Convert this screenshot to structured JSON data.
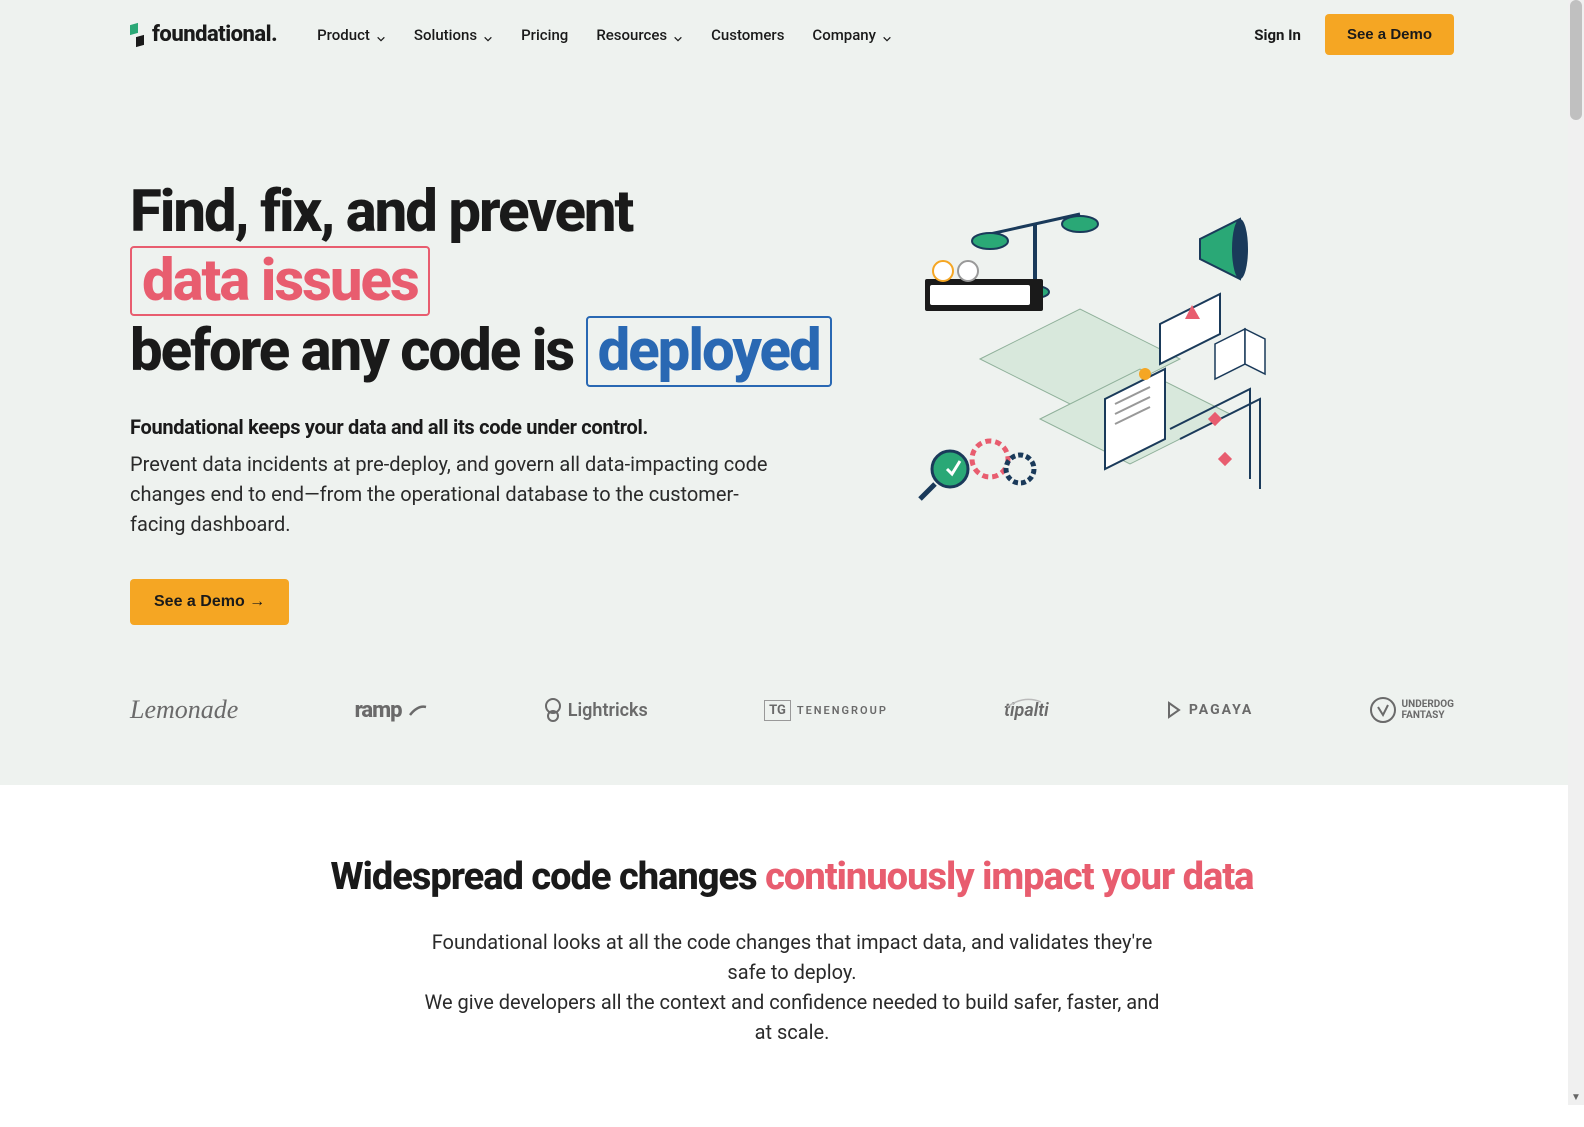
{
  "brand": {
    "name": "foundational."
  },
  "nav": {
    "items": [
      {
        "label": "Product",
        "has_chevron": true
      },
      {
        "label": "Solutions",
        "has_chevron": true
      },
      {
        "label": "Pricing",
        "has_chevron": false
      },
      {
        "label": "Resources",
        "has_chevron": true
      },
      {
        "label": "Customers",
        "has_chevron": false
      },
      {
        "label": "Company",
        "has_chevron": true
      }
    ],
    "signin": "Sign In",
    "cta": "See a Demo"
  },
  "hero": {
    "title_part1": "Find, fix, and prevent",
    "title_highlight1": "data issues",
    "title_part2": "before any code is",
    "title_highlight2": "deployed",
    "sub_bold": "Foundational keeps your data and all its code under control.",
    "sub": "Prevent data incidents at pre-deploy, and govern all data-impacting code changes end to end—from the operational database to the customer-facing dashboard.",
    "cta": "See a Demo →"
  },
  "logos": [
    "Lemonade",
    "ramp",
    "Lightricks",
    "TENENGROUP",
    "tipalti",
    "PAGAYA",
    "UNDERDOG FANTASY"
  ],
  "section2": {
    "title_part1": "Widespread code changes",
    "title_highlight": "continuously impact your data",
    "sub_line1": "Foundational looks at all the code changes that impact data, and validates they're safe to deploy.",
    "sub_line2": "We give developers all the context and confidence needed to build safer, faster, and at scale."
  }
}
